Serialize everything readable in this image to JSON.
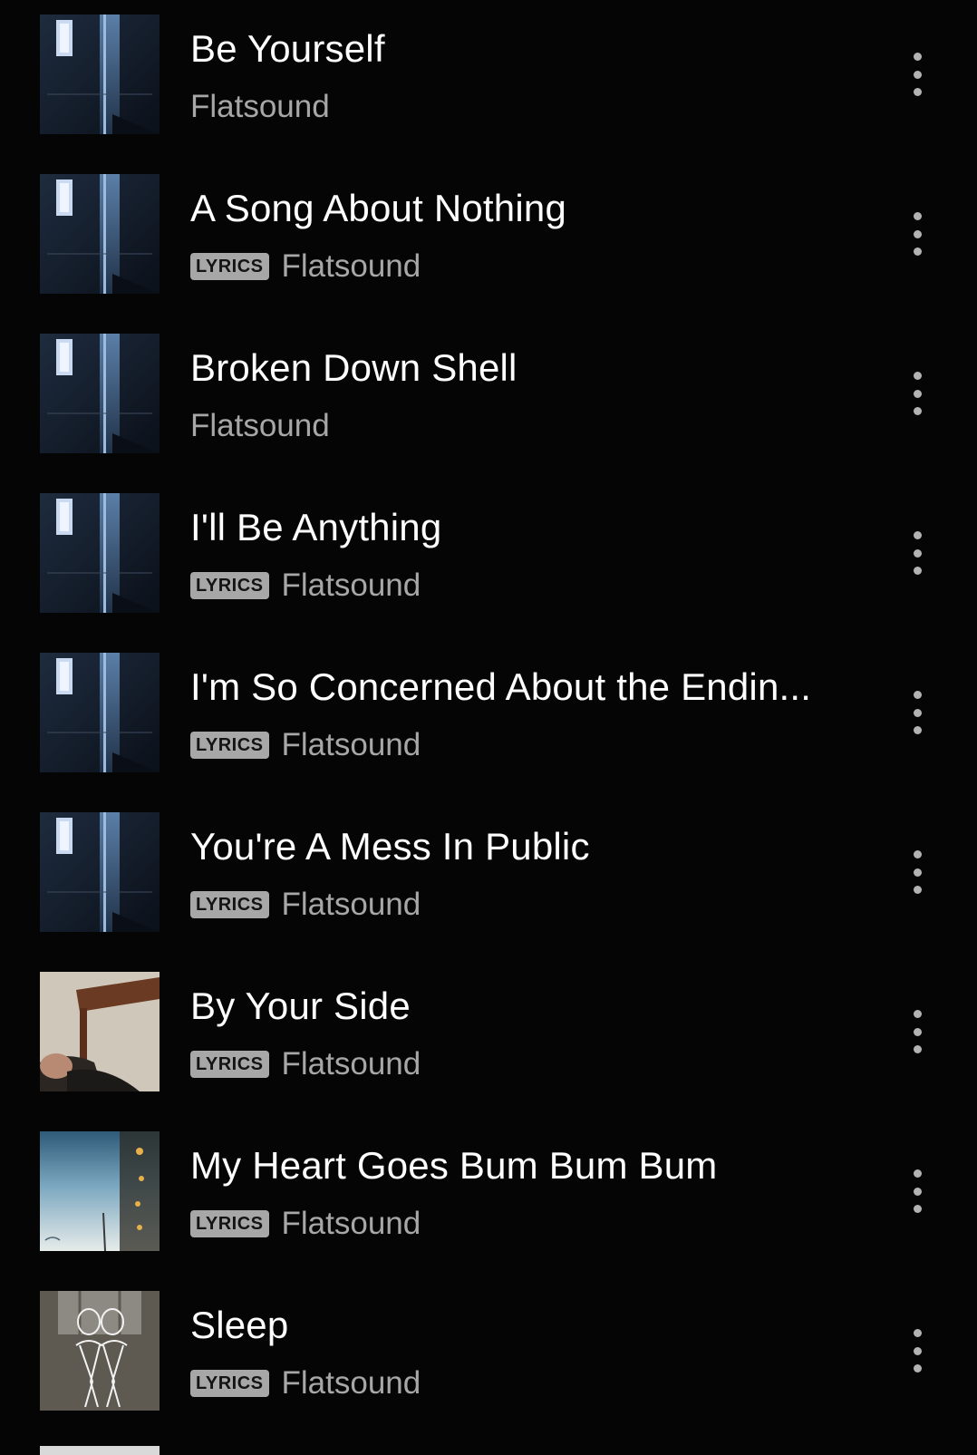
{
  "tracks": [
    {
      "title": "Be Yourself",
      "artist": "Flatsound",
      "lyrics": false,
      "cover": "window-door-art"
    },
    {
      "title": "A Song About Nothing",
      "artist": "Flatsound",
      "lyrics": true,
      "cover": "window-door-art"
    },
    {
      "title": "Broken Down Shell",
      "artist": "Flatsound",
      "lyrics": false,
      "cover": "window-door-art"
    },
    {
      "title": "I'll Be Anything",
      "artist": "Flatsound",
      "lyrics": true,
      "cover": "window-door-art"
    },
    {
      "title": "I'm So Concerned About the Endin...",
      "artist": "Flatsound",
      "lyrics": true,
      "cover": "window-door-art"
    },
    {
      "title": "You're A Mess In Public",
      "artist": "Flatsound",
      "lyrics": true,
      "cover": "window-door-art"
    },
    {
      "title": "By Your Side",
      "artist": "Flatsound",
      "lyrics": true,
      "cover": "mirror-room-art"
    },
    {
      "title": "My Heart Goes Bum Bum Bum",
      "artist": "Flatsound",
      "lyrics": true,
      "cover": "underwater-art"
    },
    {
      "title": "Sleep",
      "artist": "Flatsound",
      "lyrics": true,
      "cover": "sketch-figures-art"
    }
  ],
  "badge_label": "LYRICS",
  "more_icon": "more-vertical-icon",
  "colors": {
    "background": "#050505",
    "title": "#ffffff",
    "secondary": "#a7a7a7",
    "badge_bg": "#a7a7a7"
  }
}
